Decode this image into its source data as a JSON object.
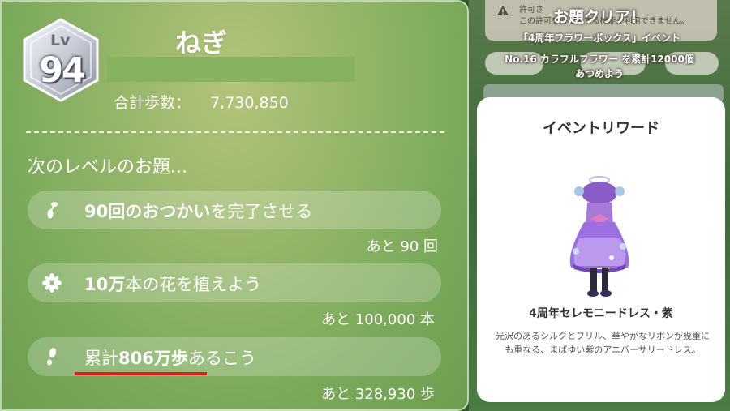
{
  "player": {
    "level_label": "Lv",
    "level": "94",
    "name": "ねぎ",
    "total_steps_label": "合計歩数：",
    "total_steps_value": "7,730,850"
  },
  "next_level": {
    "heading": "次のレベルのお題...",
    "tasks": [
      {
        "icon": "pikmin-icon",
        "bold": "90回のおつかい",
        "rest": "を完了させる",
        "remaining": "あと 90 回"
      },
      {
        "icon": "flower-icon",
        "bold": "10万",
        "rest": "本の花を植えよう",
        "remaining": "あと 100,000 本"
      },
      {
        "icon": "footprint-icon",
        "prefix": "累計",
        "bold": "806万歩",
        "rest": "あるこう",
        "remaining": "あと 328,930 歩"
      }
    ]
  },
  "background_notice": {
    "line1": "許可さ",
    "line2": "この許可を必要とする機能が利用できません。"
  },
  "quest": {
    "title": "お題クリア！",
    "subtitle": "「4周年フラワーボックス」イベント",
    "desc_line1": "No.16 カラフルフラワー を累計12000個",
    "desc_line2": "あつめよう"
  },
  "reward": {
    "heading": "イベントリワード",
    "name": "4周年セレモニードレス・紫",
    "description": "光沢のあるシルクとフリル、華やかなリボンが幾重にも重なる、まばゆい紫のアニバーサリードレス。"
  },
  "colors": {
    "red_underline": "#e01c1c",
    "panel_green": "#7aa95a"
  }
}
